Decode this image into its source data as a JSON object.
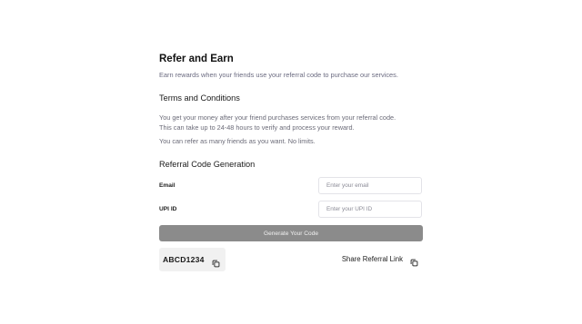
{
  "header": {
    "title": "Refer and Earn",
    "subtitle": "Earn rewards when your friends use your referral code to purchase our services."
  },
  "terms": {
    "heading": "Terms and Conditions",
    "lines": [
      "You get your money after your friend purchases services from your referral code.",
      "This can take up to 24-48 hours to verify and process your reward.",
      "You can refer as many friends as you want. No limits."
    ]
  },
  "generation": {
    "heading": "Referral Code Generation",
    "email": {
      "label": "Email",
      "placeholder": "Enter your email",
      "value": ""
    },
    "upi": {
      "label": "UPI ID",
      "placeholder": "Enter your UPI ID",
      "value": ""
    },
    "button_label": "Generate Your Code"
  },
  "referral": {
    "code": "ABCD1234",
    "copy_icon": "copy-icon",
    "share_label": "Share Referral Link",
    "share_icon": "copy-icon"
  },
  "colors": {
    "button_bg": "#8b8b8b",
    "code_bg": "#f1f1f1",
    "muted_text": "#6b6b80"
  }
}
